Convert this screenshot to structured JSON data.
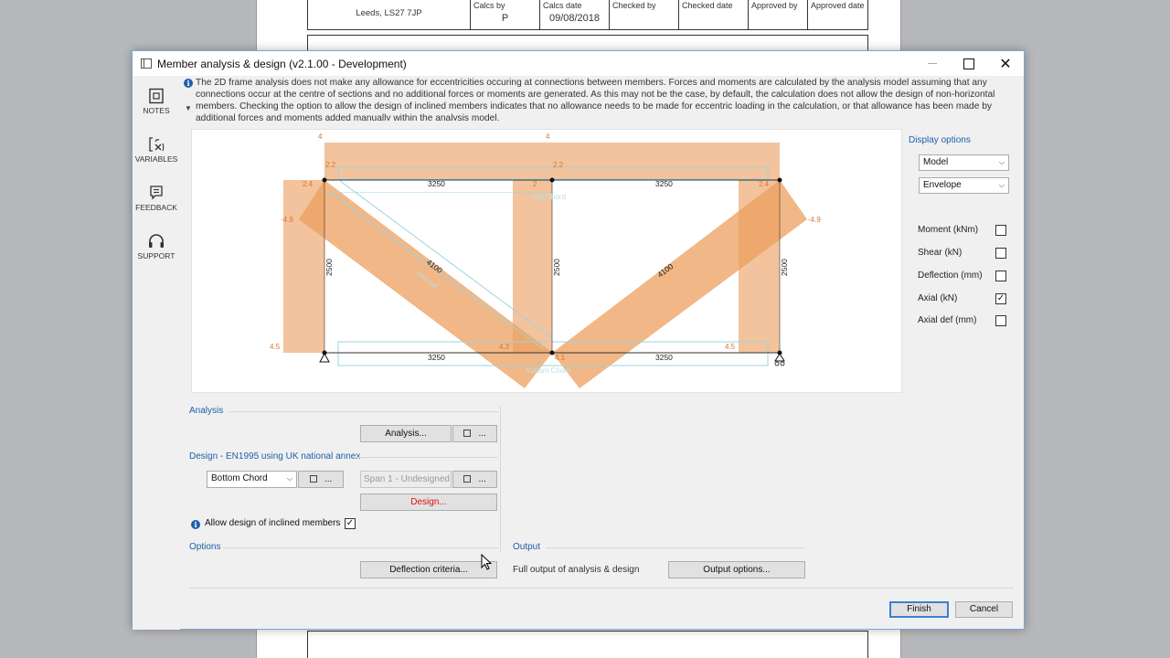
{
  "background_doc": {
    "address_line": "Leeds, LS27 7JP",
    "cols": [
      {
        "label": "Calcs by",
        "value": "P"
      },
      {
        "label": "Calcs date",
        "value": "09/08/2018"
      },
      {
        "label": "Checked by",
        "value": ""
      },
      {
        "label": "Checked date",
        "value": ""
      },
      {
        "label": "Approved by",
        "value": ""
      },
      {
        "label": "Approved date",
        "value": ""
      }
    ]
  },
  "dialog": {
    "title": "Member analysis & design (v2.1.00 - Development)",
    "close_glyph": "✕"
  },
  "sidebar": {
    "items": [
      {
        "label": "NOTES",
        "icon": "notes-icon"
      },
      {
        "label": "VARIABLES",
        "icon": "variables-icon"
      },
      {
        "label": "FEEDBACK",
        "icon": "feedback-icon"
      },
      {
        "label": "SUPPORT",
        "icon": "support-icon"
      }
    ]
  },
  "info": {
    "text": "The 2D frame analysis does not make any allowance for eccentricities occuring at connections between members. Forces and moments are calculated by the analysis model assuming that any connections occur at the centre of sections and no additional forces or moments are generated. As this may not be the case, by default, the calculation does not allow the design of non-horizontal members. Checking the option to allow the design of inclined members indicates that no allowance needs to be made for eccentric loading in the calculation, or that allowance has been made by additional forces and moments added manually within the analysis model."
  },
  "diagram": {
    "labels": {
      "top_left_4": "4",
      "top_mid_4": "4",
      "l22": "2.2",
      "m22": "2.2",
      "l24": "2.4",
      "m2": "2",
      "r24": "2.4",
      "ln49": "-4.9",
      "rn49": "-4.9",
      "top_span1": "3250",
      "top_span2": "3250",
      "bot_span1": "3250",
      "bot_span2": "3250",
      "h1": "2500",
      "h2": "2500",
      "h3": "2500",
      "diag1": "4100",
      "diag2": "4100",
      "l45": "4.5",
      "m43": "4.3",
      "m41": "4.1",
      "r45": "4.5",
      "top_chord": "Top Chord",
      "internal": "Internal",
      "bottom_chord": "Bottom Chord"
    }
  },
  "display_options": {
    "title": "Display options",
    "view_select": "Model",
    "combo_select": "Envelope",
    "toggles": [
      {
        "label": "Moment (kNm)",
        "checked": false
      },
      {
        "label": "Shear (kN)",
        "checked": false
      },
      {
        "label": "Deflection (mm)",
        "checked": false
      },
      {
        "label": "Axial (kN)",
        "checked": true
      },
      {
        "label": "Axial def (mm)",
        "checked": false
      }
    ]
  },
  "analysis": {
    "title": "Analysis",
    "button": "Analysis...",
    "more": "..."
  },
  "design": {
    "title": "Design - EN1995 using UK national annex",
    "member_select": "Bottom Chord",
    "span_select": "Span 1 - Undesigned",
    "more": "...",
    "button": "Design...",
    "allow_inclined_label": "Allow design of inclined members",
    "allow_inclined_checked": true
  },
  "options": {
    "title": "Options",
    "deflection_button": "Deflection criteria..."
  },
  "output": {
    "title": "Output",
    "description": "Full output of analysis & design",
    "button": "Output options..."
  },
  "footer": {
    "finish": "Finish",
    "cancel": "Cancel"
  },
  "check_glyph": "✓"
}
